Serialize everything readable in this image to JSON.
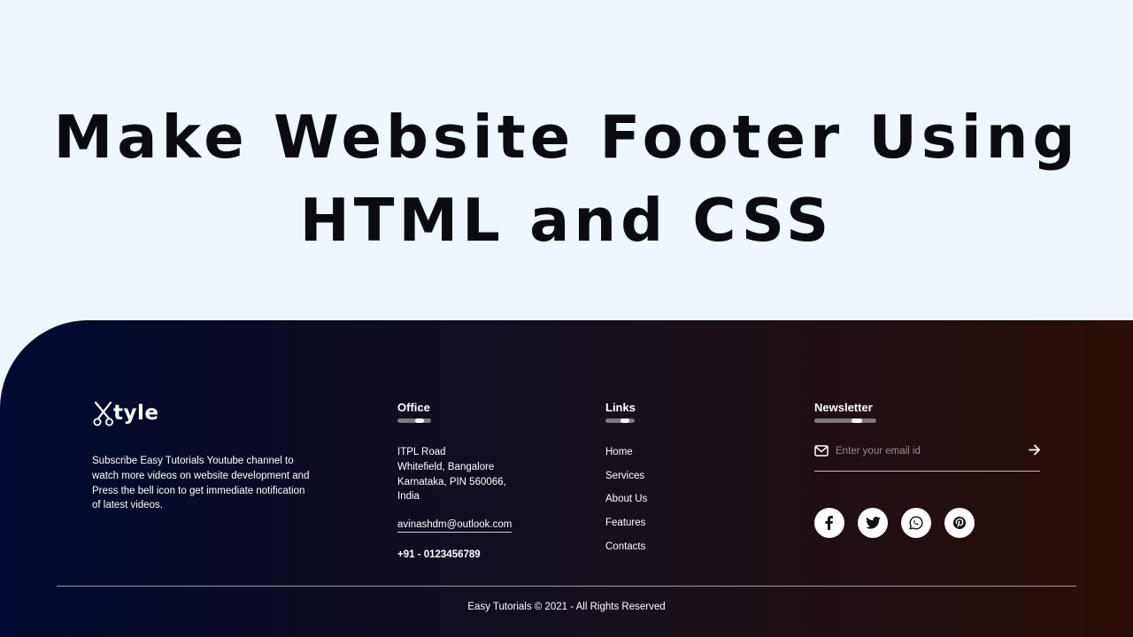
{
  "hero": {
    "title_line1": "Make Website Footer Using",
    "title_line2": "HTML and CSS"
  },
  "footer": {
    "brand": {
      "logo_text": "tyle",
      "logo_icon": "scissors-icon",
      "description": "Subscribe Easy Tutorials Youtube channel to watch more videos on website development and Press the bell icon to get immediate notification of latest videos."
    },
    "office": {
      "heading": "Office",
      "address_lines": [
        "ITPL Road",
        "Whitefield, Bangalore",
        "Karnataka, PIN 560066,",
        "India"
      ],
      "email": "avinashdm@outlook.com",
      "phone": "+91 - 0123456789"
    },
    "links": {
      "heading": "Links",
      "items": [
        "Home",
        "Services",
        "About Us",
        "Features",
        "Contacts"
      ]
    },
    "newsletter": {
      "heading": "Newsletter",
      "placeholder": "Enter your email id",
      "input_value": "",
      "mail_icon": "envelope-icon",
      "submit_icon": "arrow-right-icon"
    },
    "socials": [
      {
        "name": "facebook-icon"
      },
      {
        "name": "twitter-icon"
      },
      {
        "name": "whatsapp-icon"
      },
      {
        "name": "pinterest-icon"
      }
    ],
    "copyright": "Easy Tutorials © 2021 - All Rights Reserved"
  },
  "colors": {
    "hero_background": "#eef7fd",
    "footer_gradient_start": "#010a33",
    "footer_gradient_end": "#2b0e06",
    "text_light": "#ffffff",
    "title_text": "#0b0b10"
  }
}
